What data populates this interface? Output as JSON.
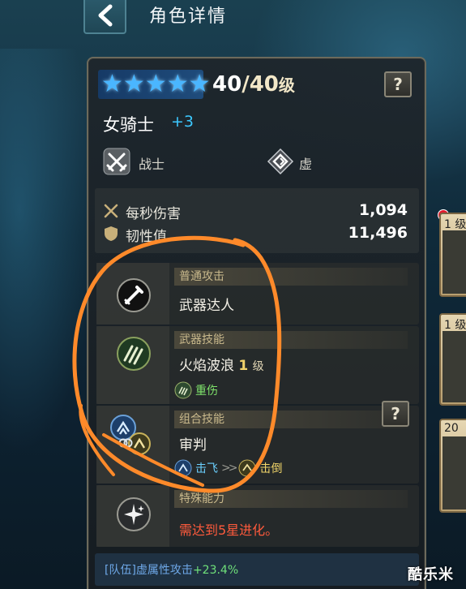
{
  "header": {
    "title": "角色详情"
  },
  "hero": {
    "level": {
      "current": "40",
      "separator": "/",
      "max": "40",
      "unit": "级"
    },
    "star_count": 5,
    "name": "女骑士",
    "plus": "+3",
    "class_label": "战士",
    "attribute_label": "虚",
    "help_label": "?"
  },
  "stats": [
    {
      "label": "每秒伤害",
      "value": "1,094",
      "icon": "crossed-swords-icon"
    },
    {
      "label": "韧性值",
      "value": "11,496",
      "icon": "shield-icon"
    }
  ],
  "skills": {
    "normal": {
      "category": "普通攻击",
      "name": "武器达人"
    },
    "weapon": {
      "category": "武器技能",
      "name": "火焰波浪",
      "level": "1",
      "level_unit": "级",
      "tag": "重伤"
    },
    "combo": {
      "category": "组合技能",
      "name": "审判",
      "tag_a": "击飞",
      "arrow": ">>",
      "tag_b": "击倒"
    },
    "special": {
      "category": "特殊能力",
      "requirement": "需达到5星进化。"
    }
  },
  "team_bonus": {
    "prefix": "[队伍]虚属性攻击",
    "value": "+23.4%"
  },
  "side_cards": [
    {
      "label": "1 级"
    },
    {
      "label": "1 级"
    },
    {
      "label": "20"
    }
  ],
  "watermark": "酷乐米",
  "colors": {
    "star": "#4ab6ff",
    "plus": "#3cc8ff",
    "skill_level": "#f1d36b",
    "requirement": "#ff5a3c",
    "bonus": "#6fe07a",
    "annotation": "#ff8a2a"
  }
}
